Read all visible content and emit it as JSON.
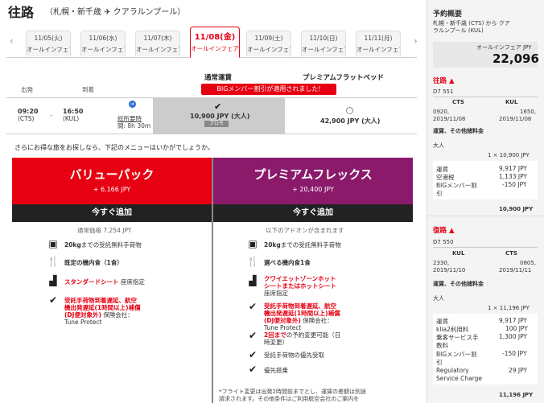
{
  "header": {
    "title": "往路",
    "route": "（札幌・新千歳 ✈ クアラルンプール）"
  },
  "date_tabs": [
    {
      "date": "11/05(火)",
      "fare": "オールインフェア"
    },
    {
      "date": "11/06(水)",
      "fare": "オールインフェア"
    },
    {
      "date": "11/07(木)",
      "fare": "オールインフェア"
    },
    {
      "date": "11/08(金)",
      "fare": "オールインフェア"
    },
    {
      "date": "11/09(土)",
      "fare": "オールインフェア"
    },
    {
      "date": "11/10(日)",
      "fare": "オールインフェア"
    },
    {
      "date": "11/11(月)",
      "fare": "オールインフェア"
    }
  ],
  "arrows": {
    "prev": "‹",
    "next": "›"
  },
  "fares": {
    "standard": "通常運賃",
    "premium": "プレミアムフラットベッド",
    "big_banner": "BIGメンバー割引が適用されました!",
    "depart_col": "出発",
    "arrive_col": "到着",
    "dep_time": "09:20",
    "dep_code": "(CTS)",
    "arr_time": "16:50",
    "arr_code": "(KUL)",
    "arrow": "➜",
    "total_time_label": "総所要時",
    "total_time": "間: 8h 30m",
    "std_price": "10,900 JPY (大人)",
    "promo": "プロモ",
    "prem_price": "42,900 JPY (大人)"
  },
  "promo_question": "さらにお得な旅をお探しなら、下記のメニューはいかがでしょうか。",
  "value_pack": {
    "title": "バリューパック",
    "price": "+ 6,166 JPY",
    "add": "今すぐ追加",
    "normal_price": "通常価格 7,254 JPY",
    "f1a": "20kg",
    "f1b": "までの受託無料手荷物",
    "f2": "既定の機内食（1食）",
    "f3a": "スタンダードシート",
    "f3b": " 座席指定",
    "f4a": "受託手荷物到着遅延、航空",
    "f4b": "機出発遅延(1時間以上)補償",
    "f4c": "(DJ便対象外)",
    "f4d": " 保険会社：",
    "f4e": "Tune Protect"
  },
  "premium_flex": {
    "title": "プレミアムフレックス",
    "price": "+ 20,400 JPY",
    "add": "今すぐ追加",
    "sub": "以下のアドオンが含まれます",
    "f1a": "20kg",
    "f1b": "までの受託無料手荷物",
    "f2": "選べる機内食1食",
    "f3a": "クワイエットゾーンホット",
    "f3b": "シートまたはホットシート",
    "f3c": "座席指定",
    "f4a": "受託手荷物到着遅延、航空",
    "f4b": "機出発遅延(1時間以上)補償",
    "f4c": "(DJ便対象外)",
    "f4d": " 保険会社：",
    "f4e": "Tune Protect",
    "f5a": "2回まで",
    "f5b": "の予約変更可能（日",
    "f5c": "時変更）",
    "f6": "受託手荷物の優先受取",
    "f7": "優先搭乗",
    "note1": "*フライト変更は出発2時間前までとし、運賃の差額は別途",
    "note2": "請求されます。その他条件はご利用航空会社のご案内を"
  },
  "summary": {
    "title": "予約概要",
    "route": "札幌・新千歳 (CTS) から クア",
    "route2": "ラルンプール (KUL)",
    "allin": "オールインフェア JPY",
    "total": "22,096",
    "out_label": "往路 ▲",
    "out_flight": "D7 551",
    "out_from": "CTS",
    "out_to": "KUL",
    "out_dep_t": "0920,",
    "out_dep_d": "2019/11/08",
    "out_arr_t": "1650,",
    "out_arr_d": "2019/11/08",
    "fare_heading": "運賃、その他諸料金",
    "adult": "大人",
    "out_adult_line": "1 × 10,900 JPY",
    "out_items": [
      {
        "label": "運賃",
        "value": "9,917 JPY"
      },
      {
        "label": "空港税",
        "value": "1,133 JPY"
      },
      {
        "label": "BIGメンバー割",
        "value": "-150 JPY"
      },
      {
        "label": "引",
        "value": ""
      }
    ],
    "out_total": "10,900 JPY",
    "ret_label": "復路 ▲",
    "ret_flight": "D7 550",
    "ret_from": "KUL",
    "ret_to": "CTS",
    "ret_dep_t": "2330,",
    "ret_dep_d": "2019/11/10",
    "ret_arr_t": "0805,",
    "ret_arr_d": "2019/11/11",
    "ret_adult_line": "1 × 11,196 JPY",
    "ret_items": [
      {
        "label": "運賃",
        "value": "9,917 JPY"
      },
      {
        "label": "klia2利用料",
        "value": "100 JPY"
      },
      {
        "label": "乗客サービス手",
        "value": "1,300 JPY"
      },
      {
        "label": "数料",
        "value": ""
      },
      {
        "label": "BIGメンバー割",
        "value": "-150 JPY"
      },
      {
        "label": "引",
        "value": ""
      },
      {
        "label": "Regulatory",
        "value": "29 JPY"
      },
      {
        "label": "Service Charge",
        "value": ""
      }
    ],
    "ret_total": "11,196 JPY"
  },
  "colors": {
    "accent": "#e60012",
    "purple": "#8b1a6b",
    "dark": "#222222"
  }
}
